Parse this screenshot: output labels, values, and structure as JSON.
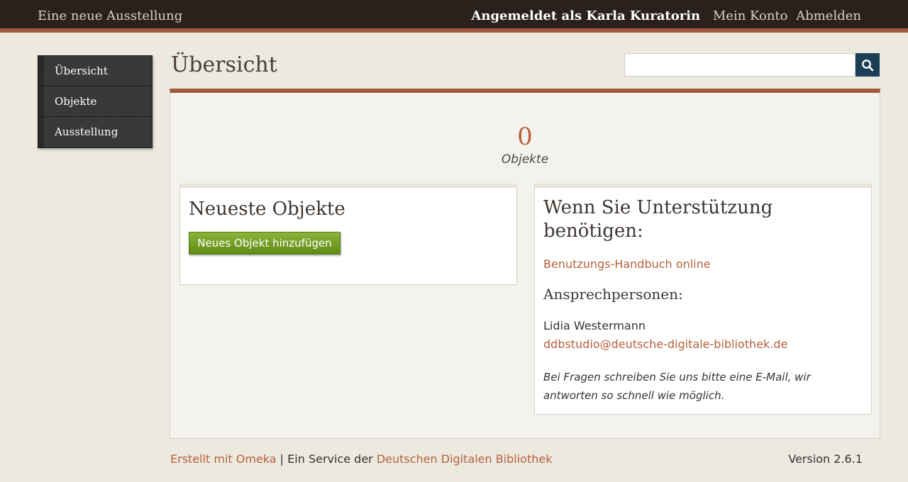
{
  "header": {
    "site_title": "Eine neue Ausstellung",
    "logged_in_text": "Angemeldet als Karla Kuratorin",
    "account_link": "Mein Konto",
    "logout_link": "Abmelden"
  },
  "sidebar": {
    "items": [
      {
        "label": "Übersicht"
      },
      {
        "label": "Objekte"
      },
      {
        "label": "Ausstellung"
      }
    ]
  },
  "main": {
    "title": "Übersicht",
    "search": {
      "value": "",
      "placeholder": ""
    },
    "stats": {
      "count": "0",
      "label": "Objekte"
    },
    "recent_items": {
      "heading": "Neueste Objekte",
      "add_button": "Neues Objekt hinzufügen"
    },
    "help": {
      "heading": "Wenn Sie Unterstützung benötigen:",
      "manual_link": "Benutzungs-Handbuch online",
      "contacts_heading": "Ansprechpersonen:",
      "contact_name": "Lidia Westermann",
      "contact_email": "ddbstudio@deutsche-digitale-bibliothek.de",
      "note": "Bei Fragen schreiben Sie uns bitte eine E-Mail, wir antworten so schnell wie möglich."
    }
  },
  "footer": {
    "omeka_link": "Erstellt mit Omeka",
    "separator": " | Ein Service der ",
    "ddb_link": "Deutschen Digitalen Bibliothek",
    "version": "Version 2.6.1"
  },
  "colors": {
    "topbar": "#2a211c",
    "accent": "#a15a3e",
    "link": "#b85f3c",
    "button_green": "#6f9b22",
    "search_button": "#1c3e57"
  },
  "icons": {
    "search_button": "search-icon"
  }
}
